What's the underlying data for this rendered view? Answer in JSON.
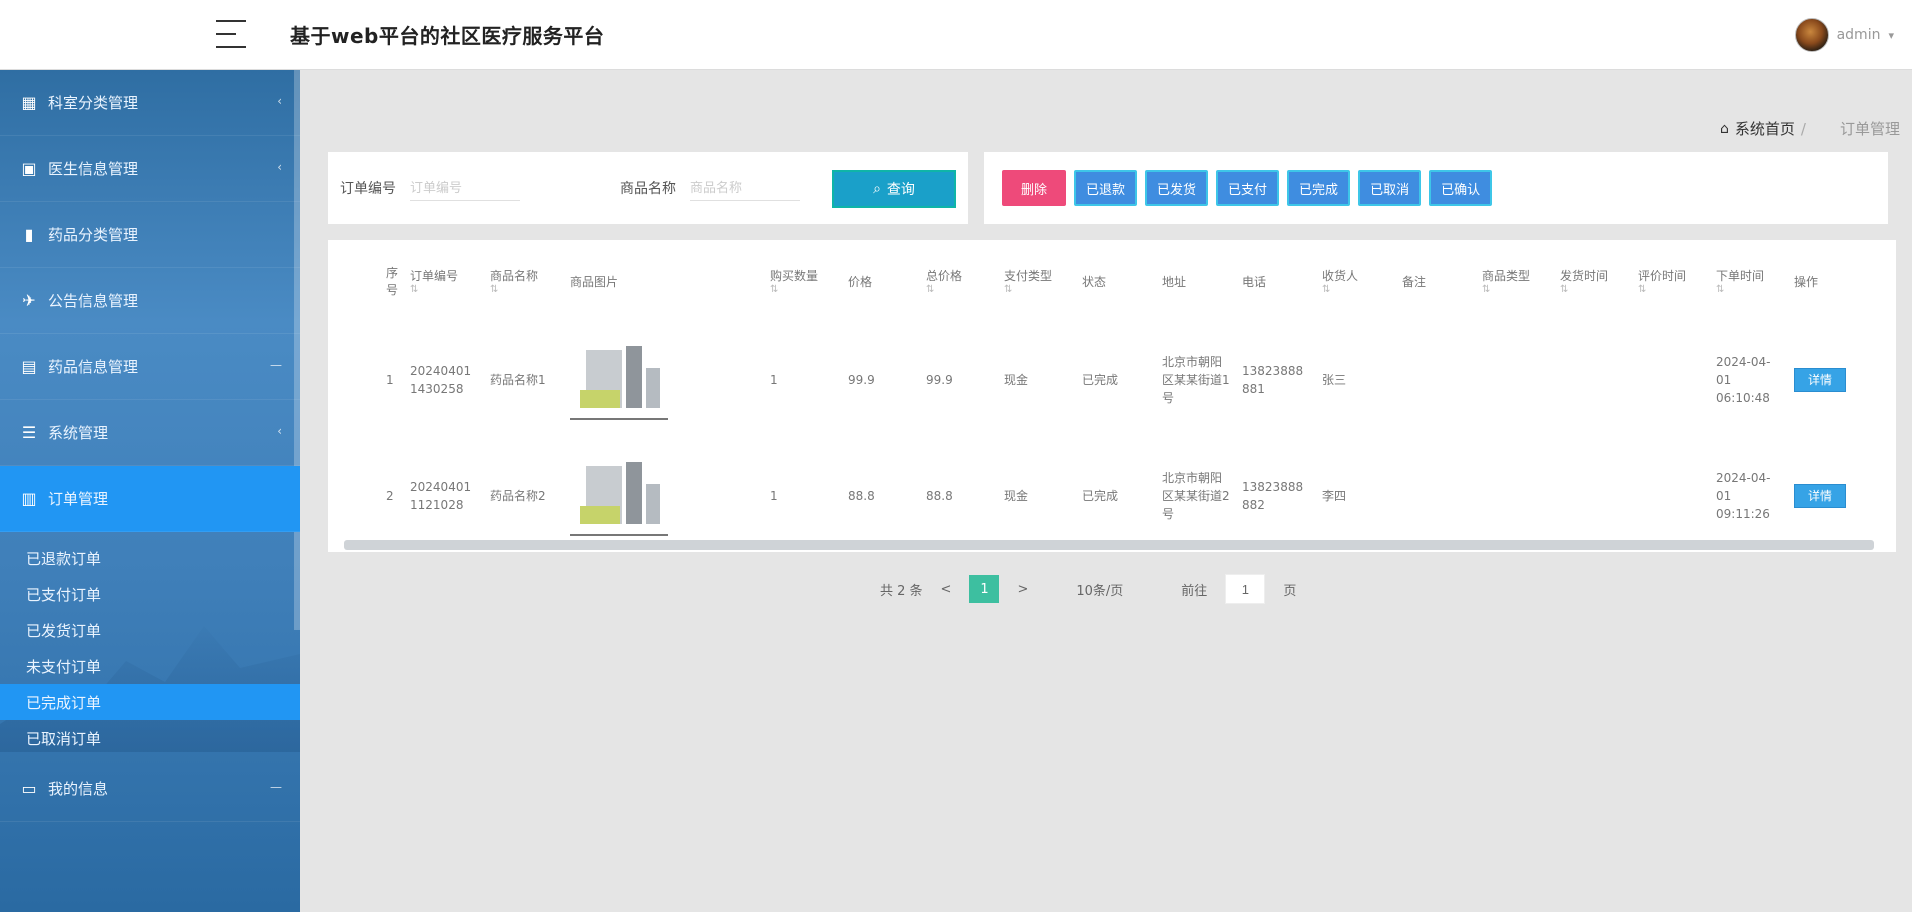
{
  "app": {
    "title": "基于web平台的社区医疗服务平台",
    "username": "admin",
    "accent_color": "#2196f3"
  },
  "sidebar": {
    "items": [
      {
        "label": "科室分类管理",
        "icon": "grid-icon"
      },
      {
        "label": "医生信息管理",
        "icon": "user-card-icon"
      },
      {
        "label": "药品分类管理",
        "icon": "chart-icon"
      },
      {
        "label": "公告信息管理",
        "icon": "pin-icon"
      },
      {
        "label": "药品信息管理",
        "icon": "box-icon"
      },
      {
        "label": "系统管理",
        "icon": "list-icon"
      },
      {
        "label": "订单管理",
        "icon": "book-icon"
      }
    ],
    "sub_items": [
      "已退款订单",
      "已支付订单",
      "已发货订单",
      "未支付订单",
      "已完成订单",
      "已取消订单"
    ],
    "profile": {
      "label": "我的信息",
      "icon": "wallet-icon"
    }
  },
  "breadcrumb": {
    "home": "系统首页",
    "current": "订单管理"
  },
  "search": {
    "order_label": "订单编号",
    "order_placeholder": "订单编号",
    "product_label": "商品名称",
    "product_placeholder": "商品名称",
    "query_button": "查询"
  },
  "actions": [
    "删除",
    "已退款",
    "已发货",
    "已支付",
    "已完成",
    "已取消",
    "已确认"
  ],
  "table": {
    "columns": [
      "序号",
      "订单编号",
      "商品名称",
      "商品图片",
      "购买数量",
      "价格",
      "总价格",
      "支付类型",
      "状态",
      "地址",
      "电话",
      "收货人",
      "备注",
      "商品类型",
      "发货时间",
      "评价时间",
      "下单时间",
      "操作"
    ],
    "rows": [
      {
        "index": "1",
        "order_no": "202404011430258",
        "product": "药品名称1",
        "quantity": "1",
        "price": "99.9",
        "total": "99.9",
        "pay_type": "现金",
        "status": "已完成",
        "address": "北京市朝阳区某某街道1号",
        "phone": "13823888881",
        "receiver": "张三",
        "remark": "",
        "product_type": "",
        "ship_time": "",
        "review_time": "",
        "order_time": "2024-04-01 06:10:48",
        "op": "详情"
      },
      {
        "index": "2",
        "order_no": "202404011121028",
        "product": "药品名称2",
        "quantity": "1",
        "price": "88.8",
        "total": "88.8",
        "pay_type": "现金",
        "status": "已完成",
        "address": "北京市朝阳区某某街道2号",
        "phone": "13823888882",
        "receiver": "李四",
        "remark": "",
        "product_type": "",
        "ship_time": "",
        "review_time": "",
        "order_time": "2024-04-01 09:11:26",
        "op": "详情"
      }
    ]
  },
  "pager": {
    "total": "共 2 条",
    "prev": "<",
    "current_page": "1",
    "next": ">",
    "page_size": "10条/页",
    "goto_label": "前往",
    "goto_value": "1",
    "goto_suffix": "页"
  }
}
